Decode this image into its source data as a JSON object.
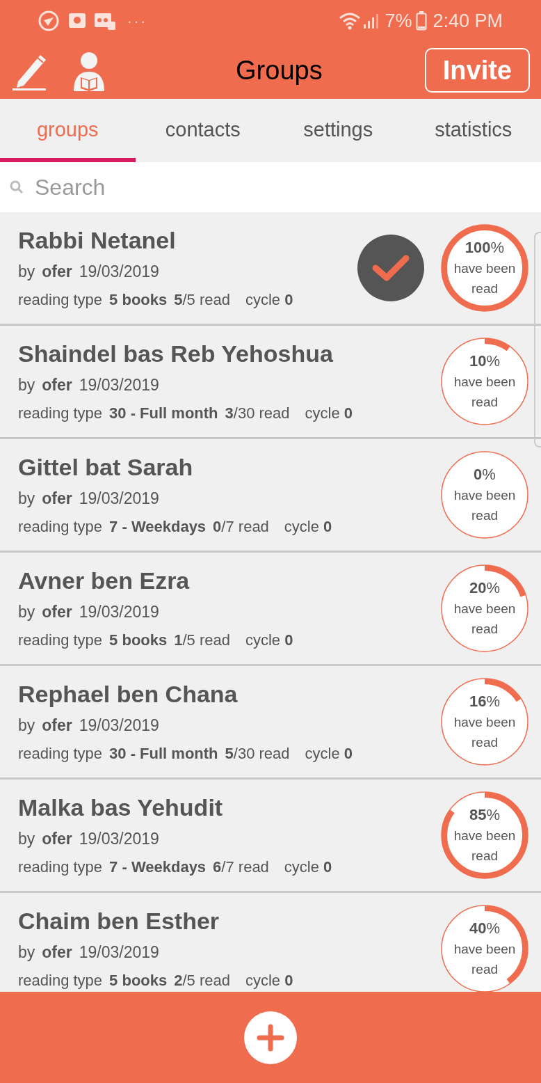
{
  "status_bar": {
    "more": "···",
    "battery": "7%",
    "time": "2:40 PM"
  },
  "header": {
    "title": "Groups",
    "invite": "Invite"
  },
  "tabs": [
    {
      "label": "groups",
      "selected": true
    },
    {
      "label": "contacts",
      "selected": false
    },
    {
      "label": "settings",
      "selected": false
    },
    {
      "label": "statistics",
      "selected": false
    }
  ],
  "search": {
    "placeholder": "Search"
  },
  "groups": [
    {
      "name": "Rabbi Netanel",
      "by": "by",
      "author": "ofer",
      "date": "19/03/2019",
      "type_label": "reading type",
      "type": "5 books",
      "read": "**5**/5 read",
      "cycle": "cycle **0**",
      "done": true,
      "percent": "**100**%",
      "caption": "have been read"
    },
    {
      "name": "Shaindel bas Reb Yehoshua",
      "by": "by",
      "author": "ofer",
      "date": "19/03/2019",
      "type_label": "reading type",
      "type": "30 - Full month",
      "read": "**3**/30 read",
      "cycle": "cycle **0**",
      "done": false,
      "percent": "**10**%",
      "caption": "have been read"
    },
    {
      "name": "Gittel bat Sarah",
      "by": "by",
      "author": "ofer",
      "date": "19/03/2019",
      "type_label": "reading type",
      "type": "7 - Weekdays",
      "read": "**0**/7 read",
      "cycle": "cycle **0**",
      "done": false,
      "percent": "**0**%",
      "caption": "have been read"
    },
    {
      "name": "Avner ben Ezra",
      "by": "by",
      "author": "ofer",
      "date": "19/03/2019",
      "type_label": "reading type",
      "type": "5 books",
      "read": "**1**/5 read",
      "cycle": "cycle **0**",
      "done": false,
      "percent": "**20**%",
      "caption": "have been read"
    },
    {
      "name": "Rephael ben Chana",
      "by": "by",
      "author": "ofer",
      "date": "19/03/2019",
      "type_label": "reading type",
      "type": "30 - Full month",
      "read": "**5**/30 read",
      "cycle": "cycle **0**",
      "done": false,
      "percent": "**16**%",
      "caption": "have been read"
    },
    {
      "name": "Malka bas Yehudit",
      "by": "by",
      "author": "ofer",
      "date": "19/03/2019",
      "type_label": "reading type",
      "type": "7 - Weekdays",
      "read": "**6**/7 read",
      "cycle": "cycle **0**",
      "done": false,
      "percent": "**85**%",
      "caption": "have been read"
    },
    {
      "name": "Chaim ben Esther",
      "by": "by",
      "author": "ofer",
      "date": "19/03/2019",
      "type_label": "reading type",
      "type": "5 books",
      "read": "**2**/5 read",
      "cycle": "cycle **0**",
      "done": false,
      "percent": "**40**%",
      "caption": "have been read"
    }
  ]
}
